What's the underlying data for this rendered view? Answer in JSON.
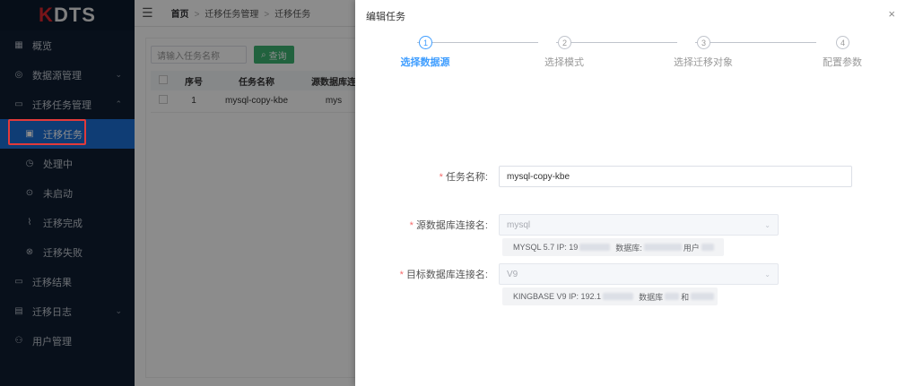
{
  "logo": {
    "k": "K",
    "rest": "DTS"
  },
  "sidebar": {
    "items": [
      {
        "label": "概览",
        "icon": "grid-icon"
      },
      {
        "label": "数据源管理",
        "icon": "database-icon"
      },
      {
        "label": "迁移任务管理",
        "icon": "folder-icon"
      },
      {
        "label": "迁移任务",
        "icon": "save-icon"
      },
      {
        "label": "处理中",
        "icon": "timer-icon"
      },
      {
        "label": "未启动",
        "icon": "play-circle-icon"
      },
      {
        "label": "迁移完成",
        "icon": "chart-icon"
      },
      {
        "label": "迁移失败",
        "icon": "close-circle-icon"
      },
      {
        "label": "迁移结果",
        "icon": "folder-icon"
      },
      {
        "label": "迁移日志",
        "icon": "document-icon"
      },
      {
        "label": "用户管理",
        "icon": "user-icon"
      }
    ]
  },
  "breadcrumb": {
    "home": "首页",
    "level1": "迁移任务管理",
    "level2": "迁移任务"
  },
  "search": {
    "placeholder": "请输入任务名称",
    "button": "查询"
  },
  "table": {
    "headers": [
      "序号",
      "任务名称",
      "源数据库连"
    ],
    "rows": [
      {
        "index": "1",
        "name": "mysql-copy-kbe",
        "src": "mys"
      }
    ]
  },
  "drawer": {
    "title": "编辑任务",
    "close": "×",
    "steps": [
      {
        "num": "1",
        "label": "选择数据源"
      },
      {
        "num": "2",
        "label": "选择模式"
      },
      {
        "num": "3",
        "label": "选择迁移对象"
      },
      {
        "num": "4",
        "label": "配置参数"
      }
    ],
    "form": {
      "task_name_label": "任务名称:",
      "task_name_value": "mysql-copy-kbe",
      "source_label": "源数据库连接名:",
      "source_value": "mysql",
      "source_info_a": "MYSQL 5.7 IP: 19",
      "source_info_b": "数据库:",
      "source_info_c": "用户",
      "target_label": "目标数据库连接名:",
      "target_value": "V9",
      "target_info_a": "KINGBASE V9 IP: 192.1",
      "target_info_b": "数据库",
      "target_info_c": "和"
    }
  }
}
